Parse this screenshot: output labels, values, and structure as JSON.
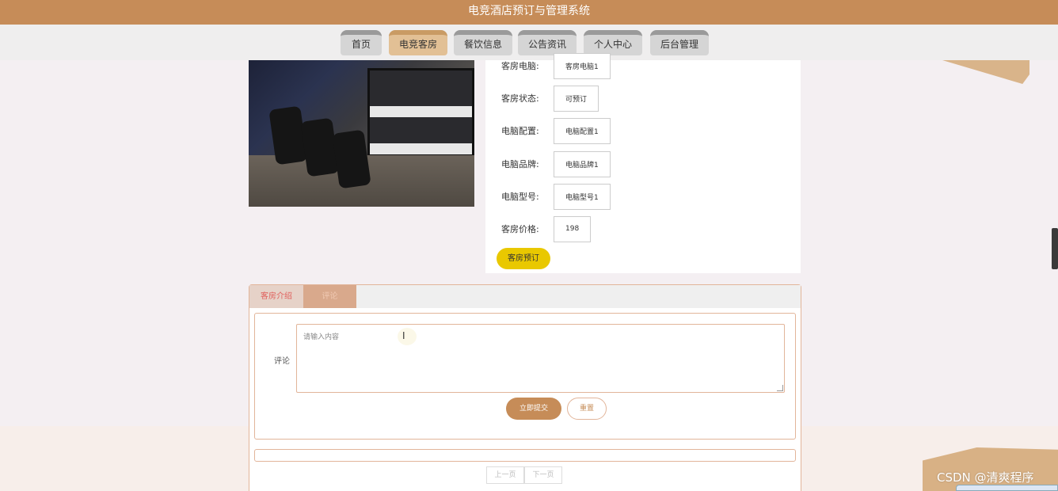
{
  "app": {
    "title": "电竞酒店预订与管理系统"
  },
  "nav": {
    "items": [
      {
        "label": "首页"
      },
      {
        "label": "电竞客房",
        "active": true
      },
      {
        "label": "餐饮信息"
      },
      {
        "label": "公告资讯"
      },
      {
        "label": "个人中心"
      },
      {
        "label": "后台管理"
      }
    ]
  },
  "room": {
    "fields": [
      {
        "label": "客房电脑:",
        "value": "客房电脑1"
      },
      {
        "label": "客房状态:",
        "value": "可预订"
      },
      {
        "label": "电脑配置:",
        "value": "电脑配置1"
      },
      {
        "label": "电脑品牌:",
        "value": "电脑品牌1"
      },
      {
        "label": "电脑型号:",
        "value": "电脑型号1"
      },
      {
        "label": "客房价格:",
        "value": "198"
      }
    ],
    "book_label": "客房预订"
  },
  "tabs": [
    {
      "label": "客房介绍"
    },
    {
      "label": "评论",
      "active": true
    }
  ],
  "comment": {
    "label": "评论",
    "placeholder": "请输入内容",
    "submit_label": "立即提交",
    "reset_label": "重置"
  },
  "pager": {
    "prev_label": "上一页",
    "next_label": "下一页"
  },
  "watermark": "CSDN @清爽程序",
  "colors": {
    "brand": "#c68c58",
    "nav_active": "#e2c095",
    "book_button": "#e9c800"
  }
}
